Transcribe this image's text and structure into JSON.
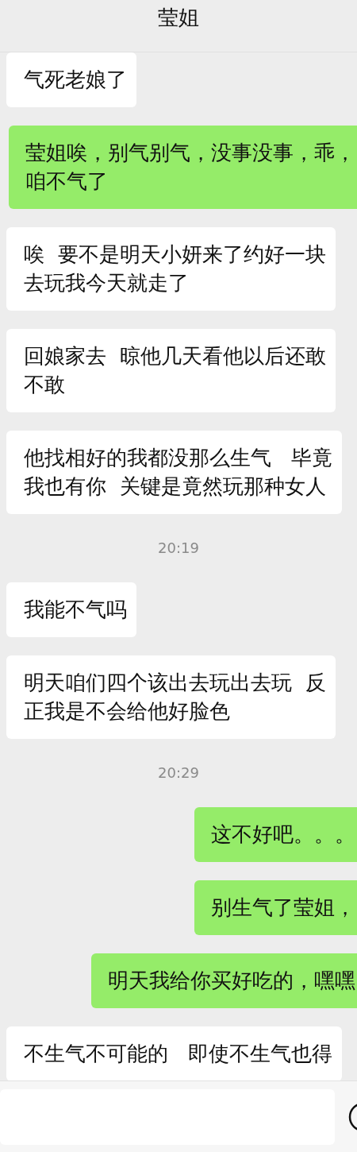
{
  "header": {
    "title": "莹姐"
  },
  "messages": [
    {
      "kind": "received",
      "lines": [
        "气死老娘了"
      ]
    },
    {
      "kind": "sent",
      "lines": [
        "莹姐唉，别气别气，没事没事，乖，",
        "咱不气了"
      ]
    },
    {
      "kind": "received",
      "lines": [
        "唉  要不是明天小妍来了约好一块",
        "去玩我今天就走了"
      ]
    },
    {
      "kind": "received",
      "lines": [
        "回娘家去  晾他几天看他以后还敢",
        "不敢"
      ]
    },
    {
      "kind": "received",
      "lines": [
        "他找相好的我都没那么生气   毕竟",
        "我也有你  关键是竟然玩那种女人"
      ]
    },
    {
      "kind": "time",
      "lines": [
        "20:19"
      ]
    },
    {
      "kind": "received",
      "lines": [
        "我能不气吗"
      ]
    },
    {
      "kind": "received",
      "lines": [
        "明天咱们四个该出去玩出去玩  反",
        "正我是不会给他好脸色"
      ]
    },
    {
      "kind": "time",
      "lines": [
        "20:29"
      ]
    },
    {
      "kind": "sent",
      "lines": [
        "这不好吧。。。"
      ]
    },
    {
      "kind": "sent",
      "lines": [
        "别生气了莹姐，"
      ]
    },
    {
      "kind": "sent",
      "lines": [
        "明天我给你买好吃的，嘿嘿"
      ]
    },
    {
      "kind": "received",
      "lines": [
        "不生气不可能的   即使不生气也得"
      ]
    }
  ]
}
